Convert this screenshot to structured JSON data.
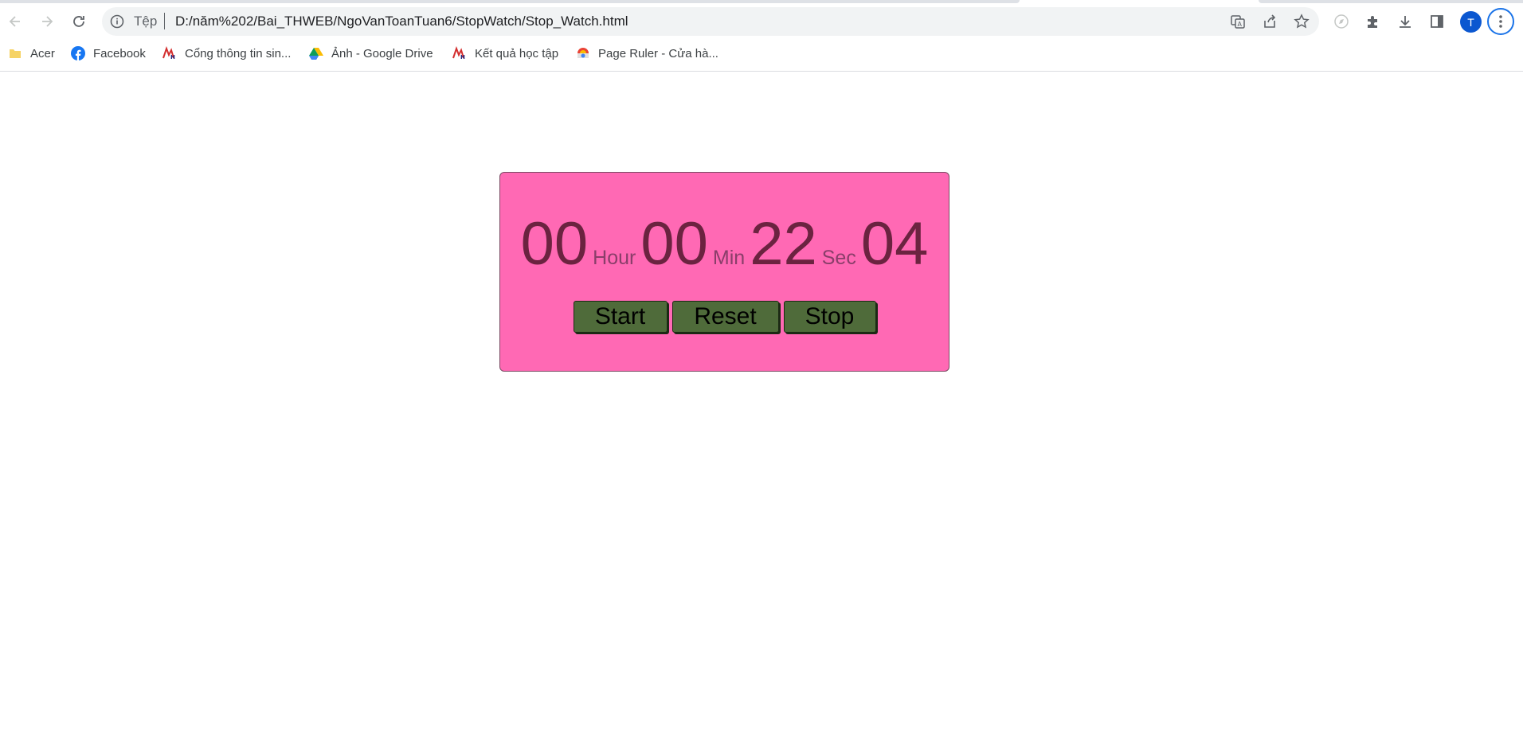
{
  "browser": {
    "scheme_label": "Tệp",
    "url": "D:/năm%202/Bai_THWEB/NgoVanToanTuan6/StopWatch/Stop_Watch.html",
    "avatar_letter": "T",
    "bookmarks": [
      {
        "label": "Acer",
        "icon": "folder-icon"
      },
      {
        "label": "Facebook",
        "icon": "facebook-icon"
      },
      {
        "label": "Cổng thông tin sin...",
        "icon": "school-logo-icon"
      },
      {
        "label": "Ảnh - Google Drive",
        "icon": "google-drive-icon"
      },
      {
        "label": "Kết quả học tập",
        "icon": "school-logo-icon"
      },
      {
        "label": "Page Ruler - Cửa hà...",
        "icon": "chrome-webstore-icon"
      }
    ]
  },
  "stopwatch": {
    "hours": "00",
    "hour_label": "Hour",
    "minutes": "00",
    "min_label": "Min",
    "seconds": "22",
    "sec_label": "Sec",
    "centiseconds": "04",
    "start_label": "Start",
    "reset_label": "Reset",
    "stop_label": "Stop"
  },
  "colors": {
    "panel": "#ff69b4",
    "digits": "#6b2340",
    "button": "#4f6b3a"
  }
}
